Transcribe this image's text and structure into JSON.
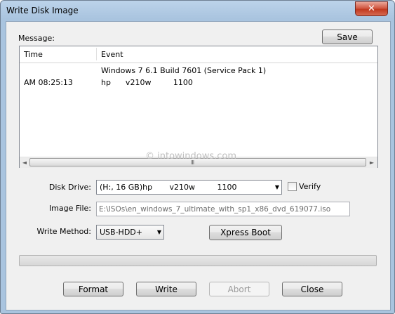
{
  "window": {
    "title": "Write Disk Image",
    "close_glyph": "✕"
  },
  "message": {
    "label": "Message:",
    "save_label": "Save"
  },
  "log": {
    "columns": {
      "time": "Time",
      "event": "Event"
    },
    "rows": [
      {
        "time": "",
        "event": "Windows 7 6.1 Build 7601 (Service Pack 1)"
      },
      {
        "time": "AM 08:25:13",
        "event": "hp      v210w         1100"
      }
    ],
    "scroll_left": "◄",
    "scroll_right": "►",
    "scroll_grip": "III"
  },
  "watermark": "© intowindows.com",
  "form": {
    "disk_drive_label": "Disk Drive:",
    "disk_drive_value": "(H:, 16 GB)hp       v210w         1100",
    "verify_label": "Verify",
    "image_file_label": "Image File:",
    "image_file_value": "E:\\ISOs\\en_windows_7_ultimate_with_sp1_x86_dvd_619077.iso",
    "write_method_label": "Write Method:",
    "write_method_value": "USB-HDD+",
    "xpress_label": "Xpress Boot",
    "dropdown_glyph": "▼"
  },
  "progress": {
    "value": 0
  },
  "actions": {
    "format": "Format",
    "write": "Write",
    "abort": "Abort",
    "close": "Close"
  }
}
